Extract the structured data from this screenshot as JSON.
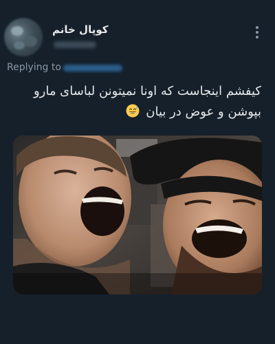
{
  "tweet": {
    "display_name": "کوپال خانم",
    "replying_label": "Replying to",
    "text_line1": "کیفشم اینجاست که اونا نمیتونن لباسای مارو",
    "text_line2": "بپوشن و عوض در بیان",
    "emoji_name": "grinning-sweat-emoji",
    "more_icon": "more-vertical-icon",
    "media": {
      "alt_description_none": ""
    }
  },
  "colors": {
    "background": "#15202b",
    "text_primary": "#e7e9ea",
    "text_secondary": "#8b98a5",
    "link": "#1d9bf0"
  }
}
